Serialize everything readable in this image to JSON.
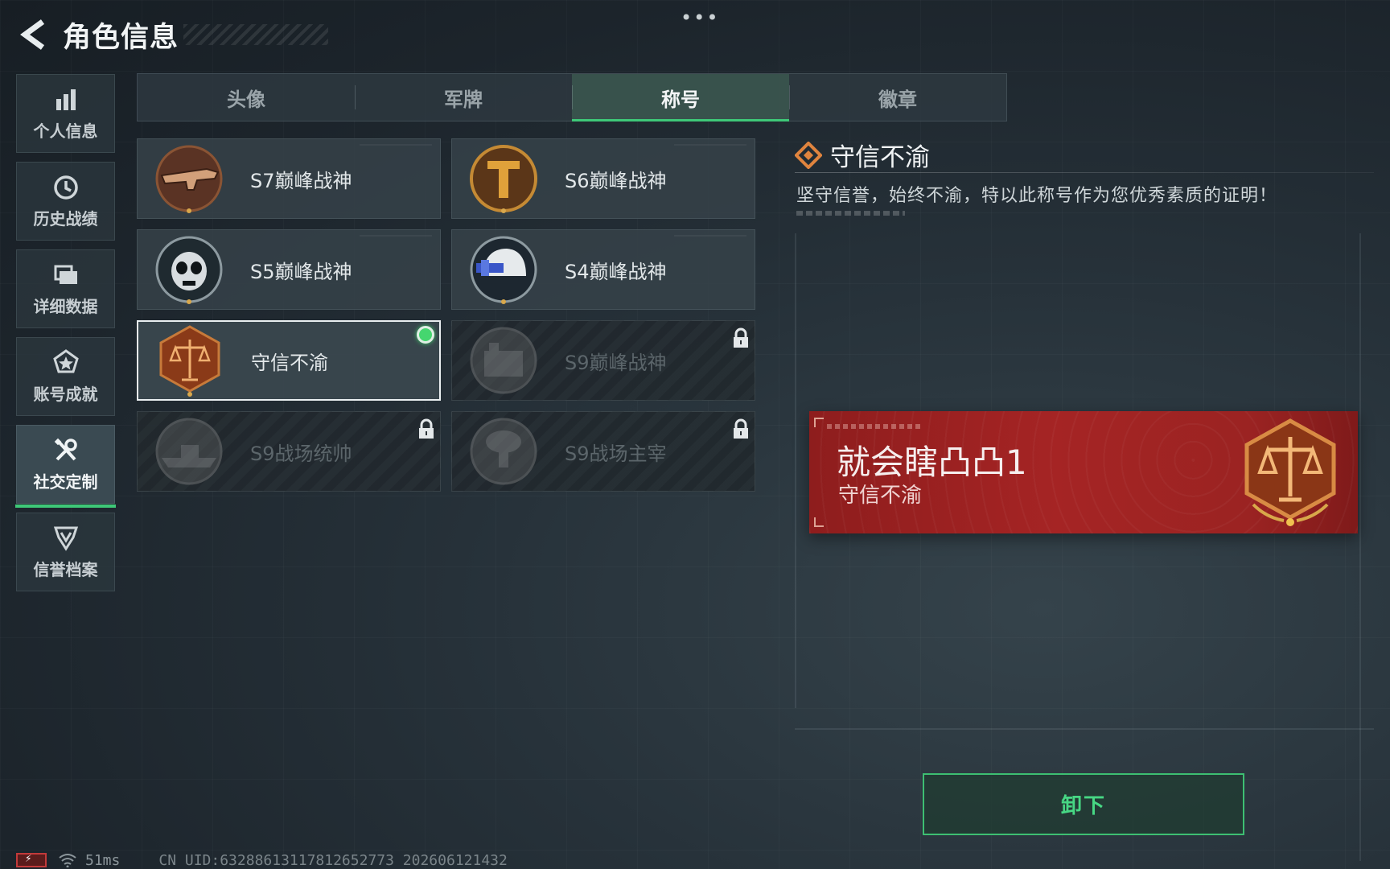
{
  "header": {
    "title": "角色信息",
    "more": "•••"
  },
  "sidebar": {
    "items": [
      {
        "label": "个人信息",
        "icon": "bar-chart-icon"
      },
      {
        "label": "历史战绩",
        "icon": "clock-history-icon"
      },
      {
        "label": "详细数据",
        "icon": "folder-stack-icon"
      },
      {
        "label": "账号成就",
        "icon": "achievement-star-icon"
      },
      {
        "label": "社交定制",
        "icon": "wrench-screwdriver-icon",
        "active": true
      },
      {
        "label": "信誉档案",
        "icon": "shield-chevron-icon"
      }
    ]
  },
  "tabs": [
    {
      "label": "头像"
    },
    {
      "label": "军牌"
    },
    {
      "label": "称号",
      "active": true
    },
    {
      "label": "徽章"
    }
  ],
  "titles": [
    {
      "name": "S7巅峰战神",
      "emblem": "rifle-emblem-icon",
      "locked": false
    },
    {
      "name": "S6巅峰战神",
      "emblem": "t-shield-emblem-icon",
      "locked": false
    },
    {
      "name": "S5巅峰战神",
      "emblem": "skull-mask-emblem-icon",
      "locked": false
    },
    {
      "name": "S4巅峰战神",
      "emblem": "helmet-nvg-emblem-icon",
      "locked": false
    },
    {
      "name": "守信不渝",
      "emblem": "scales-emblem-icon",
      "locked": false,
      "equipped": true
    },
    {
      "name": "S9巅峰战神",
      "emblem": "fortress-emblem-icon",
      "locked": true
    },
    {
      "name": "S9战场统帅",
      "emblem": "warship-emblem-icon",
      "locked": true
    },
    {
      "name": "S9战场主宰",
      "emblem": "mushroom-cloud-emblem-icon",
      "locked": true
    }
  ],
  "detail": {
    "title": "守信不渝",
    "description": "坚守信誉，始终不渝，特以此称号作为您优秀素质的证明！"
  },
  "preview": {
    "player_name": "就会瞎凸凸1",
    "title": "守信不渝"
  },
  "actions": {
    "unequip": "卸下"
  },
  "status": {
    "ping": "51ms",
    "uid": "CN UID:6328861311781265277З 202606121432"
  },
  "colors": {
    "accent": "#3ec878",
    "preview_red": "#a52424",
    "emblem_bronze": "#c06a32"
  }
}
